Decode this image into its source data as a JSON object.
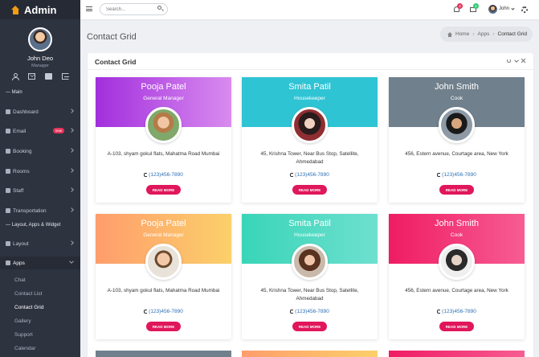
{
  "brand": {
    "name": "Admin"
  },
  "sidebar": {
    "profile": {
      "name": "John Deo",
      "role": "Manager"
    },
    "main_label": "— Main",
    "items": [
      {
        "label": "Dashboard",
        "icon": "dashboard-icon"
      },
      {
        "label": "Email",
        "icon": "email-icon",
        "badge": "new"
      },
      {
        "label": "Booking",
        "icon": "booking-icon"
      },
      {
        "label": "Rooms",
        "icon": "key-icon"
      },
      {
        "label": "Staff",
        "icon": "staff-icon"
      },
      {
        "label": "Transportation",
        "icon": "bus-icon"
      }
    ],
    "layout_label": "— Layout, Apps & Widget",
    "layout_item": {
      "label": "Layout",
      "icon": "monitor-icon"
    },
    "apps_item": {
      "label": "Apps",
      "icon": "puzzle-icon"
    },
    "apps_sub": [
      "Chat",
      "Contact List",
      "Contact Grid",
      "Gallery",
      "Support",
      "Calendar"
    ]
  },
  "topbar": {
    "search_placeholder": "Search...",
    "notification_count": "4",
    "mail_count": "2",
    "user": "John"
  },
  "page": {
    "title": "Contact Grid",
    "breadcrumb": [
      "Home",
      "Apps",
      "Contact Grid"
    ]
  },
  "panel": {
    "title": "Contact Grid"
  },
  "cards": [
    {
      "name": "Pooja Patel",
      "role": "General Manager",
      "address": "A-103, shyam gokul flats, Mahatma Road Mumbai",
      "phone": "(123)456-7890",
      "button": "READ MORE",
      "color": "purple"
    },
    {
      "name": "Smita Patil",
      "role": "Housekeeper",
      "address": "45, Krishna Tower, Near Bus Stop, Satellite, Ahmedabad",
      "phone": "(123)456-7890",
      "button": "READ MORE",
      "color": "cyan"
    },
    {
      "name": "John Smith",
      "role": "Cook",
      "address": "456, Estern avenue, Courtage area, New York",
      "phone": "(123)456-7890",
      "button": "READ MORE",
      "color": "gray"
    },
    {
      "name": "Pooja Patel",
      "role": "General Manager",
      "address": "A-103, shyam gokul flats, Mahatma Road Mumbai",
      "phone": "(123)456-7890",
      "button": "READ MORE",
      "color": "orange"
    },
    {
      "name": "Smita Patil",
      "role": "Housekeeper",
      "address": "45, Krishna Tower, Near Bus Stop, Satellite, Ahmedabad",
      "phone": "(123)456-7890",
      "button": "READ MORE",
      "color": "teal"
    },
    {
      "name": "John Smith",
      "role": "Cook",
      "address": "456, Estern avenue, Courtage area, New York",
      "phone": "(123)456-7890",
      "button": "READ MORE",
      "color": "pink"
    }
  ]
}
